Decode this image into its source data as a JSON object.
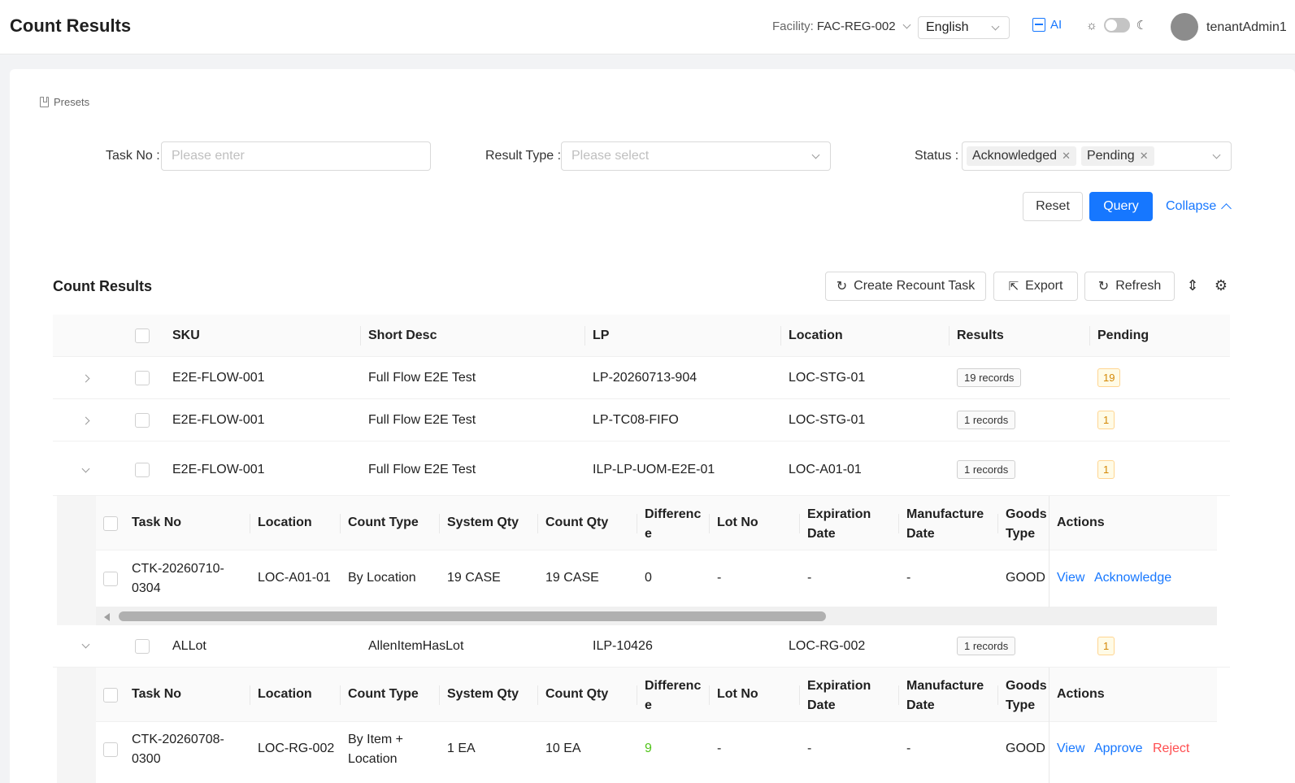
{
  "header": {
    "title": "Count Results",
    "facility_label": "Facility:",
    "facility_value": "FAC-REG-002",
    "language": "English",
    "ai_label": "AI",
    "username": "tenantAdmin1"
  },
  "filters": {
    "presets_label": "Presets",
    "task_no_label": "Task No",
    "task_no_placeholder": "Please enter",
    "result_type_label": "Result Type",
    "result_type_placeholder": "Please select",
    "status_label": "Status",
    "status_tags": [
      "Acknowledged",
      "Pending"
    ],
    "reset_label": "Reset",
    "query_label": "Query",
    "collapse_label": "Collapse"
  },
  "toolbar": {
    "section_title": "Count Results",
    "create_recount_label": "Create Recount Task",
    "export_label": "Export",
    "refresh_label": "Refresh"
  },
  "table": {
    "columns": [
      "SKU",
      "Short Desc",
      "LP",
      "Location",
      "Results",
      "Pending"
    ],
    "rows": [
      {
        "sku": "E2E-FLOW-001",
        "desc": "Full Flow E2E Test",
        "lp": "LP-20260713-904",
        "location": "LOC-STG-01",
        "results": "19 records",
        "pending": "19",
        "expanded": false
      },
      {
        "sku": "E2E-FLOW-001",
        "desc": "Full Flow E2E Test",
        "lp": "LP-TC08-FIFO",
        "location": "LOC-STG-01",
        "results": "1 records",
        "pending": "1",
        "expanded": false
      },
      {
        "sku": "E2E-FLOW-001",
        "desc": "Full Flow E2E Test",
        "lp": "ILP-LP-UOM-E2E-01",
        "location": "LOC-A01-01",
        "results": "1 records",
        "pending": "1",
        "expanded": true
      },
      {
        "sku": "ALLot",
        "desc": "AllenItemHasLot",
        "lp": "ILP-10426",
        "location": "LOC-RG-002",
        "results": "1 records",
        "pending": "1",
        "expanded": true
      }
    ]
  },
  "nested": {
    "columns": {
      "task_no": "Task No",
      "location": "Location",
      "count_type": "Count Type",
      "system_qty": "System Qty",
      "count_qty": "Count Qty",
      "difference_1": "Differenc",
      "difference_2": "e",
      "lot_no": "Lot No",
      "expiration_1": "Expiration",
      "expiration_2": "Date",
      "manufacture_1": "Manufacture",
      "manufacture_2": "Date",
      "goods_1": "Goods",
      "goods_2": "Type",
      "actions": "Actions"
    },
    "detail_1": {
      "task_no_1": "CTK-20260710-",
      "task_no_2": "0304",
      "location": "LOC-A01-01",
      "count_type": "By Location",
      "system_qty": "19 CASE",
      "count_qty": "19 CASE",
      "difference": "0",
      "lot_no": "-",
      "expiration": "-",
      "manufacture": "-",
      "goods_type": "GOOD",
      "action_view": "View",
      "action_acknowledge": "Acknowledge"
    },
    "detail_2": {
      "task_no_1": "CTK-20260708-",
      "task_no_2": "0300",
      "location": "LOC-RG-002",
      "count_type_1": "By Item +",
      "count_type_2": "Location",
      "system_qty": "1 EA",
      "count_qty": "10 EA",
      "difference": "9",
      "lot_no": "-",
      "expiration": "-",
      "manufacture": "-",
      "goods_type": "GOOD",
      "action_view": "View",
      "action_approve": "Approve",
      "action_reject": "Reject"
    }
  },
  "colors": {
    "primary": "#1677ff",
    "danger": "#ff4d4f",
    "success": "#52c41a",
    "warning": "#d48806"
  }
}
